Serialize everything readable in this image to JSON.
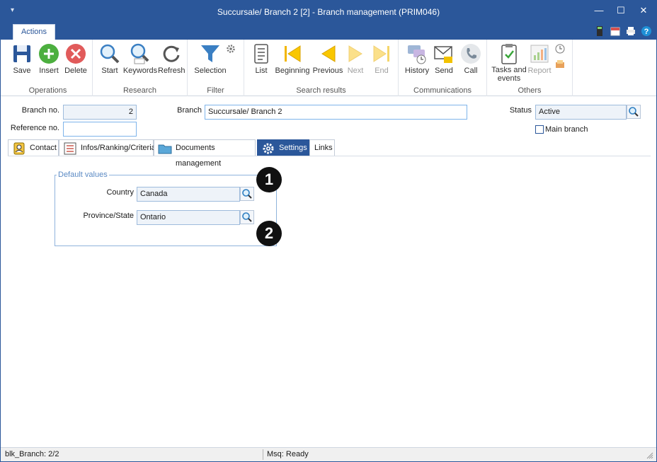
{
  "window": {
    "title": "Succursale/ Branch 2 [2] - Branch management (PRIM046)",
    "controls": {
      "minimize": "—",
      "maximize": "☐",
      "close": "✕"
    }
  },
  "ribbon": {
    "active_tab": "Actions",
    "groups": {
      "operations": {
        "label": "Operations",
        "save": "Save",
        "insert": "Insert",
        "delete": "Delete"
      },
      "research": {
        "label": "Research",
        "start": "Start",
        "keywords": "Keywords",
        "refresh": "Refresh"
      },
      "filter": {
        "label": "Filter",
        "selection": "Selection"
      },
      "search_results": {
        "label": "Search results",
        "list": "List",
        "beginning": "Beginning",
        "previous": "Previous",
        "next": "Next",
        "end": "End"
      },
      "communications": {
        "label": "Communications",
        "history": "History",
        "send": "Send",
        "call": "Call"
      },
      "others": {
        "label": "Others",
        "tasks_line1": "Tasks and",
        "tasks_line2": "events",
        "report": "Report"
      }
    }
  },
  "form": {
    "branch_no_label": "Branch no.",
    "branch_no_value": "2",
    "reference_no_label": "Reference no.",
    "reference_no_value": "",
    "branch_label": "Branch",
    "branch_value": "Succursale/ Branch 2",
    "status_label": "Status",
    "status_value": "Active",
    "main_branch_label": "Main branch"
  },
  "tabs": {
    "contact": "Contact",
    "infos": "Infos/Ranking/Criteria",
    "documents": "Documents management",
    "settings": "Settings",
    "links": "Links"
  },
  "settings": {
    "group_label": "Default values",
    "country_label": "Country",
    "country_value": "Canada",
    "province_label": "Province/State",
    "province_value": "Ontario"
  },
  "callouts": {
    "one": "1",
    "two": "2"
  },
  "statusbar": {
    "block": "blk_Branch: 2/2",
    "message": "Msq: Ready"
  },
  "colors": {
    "accent": "#2b579a",
    "field_border": "#7eb4ea"
  }
}
